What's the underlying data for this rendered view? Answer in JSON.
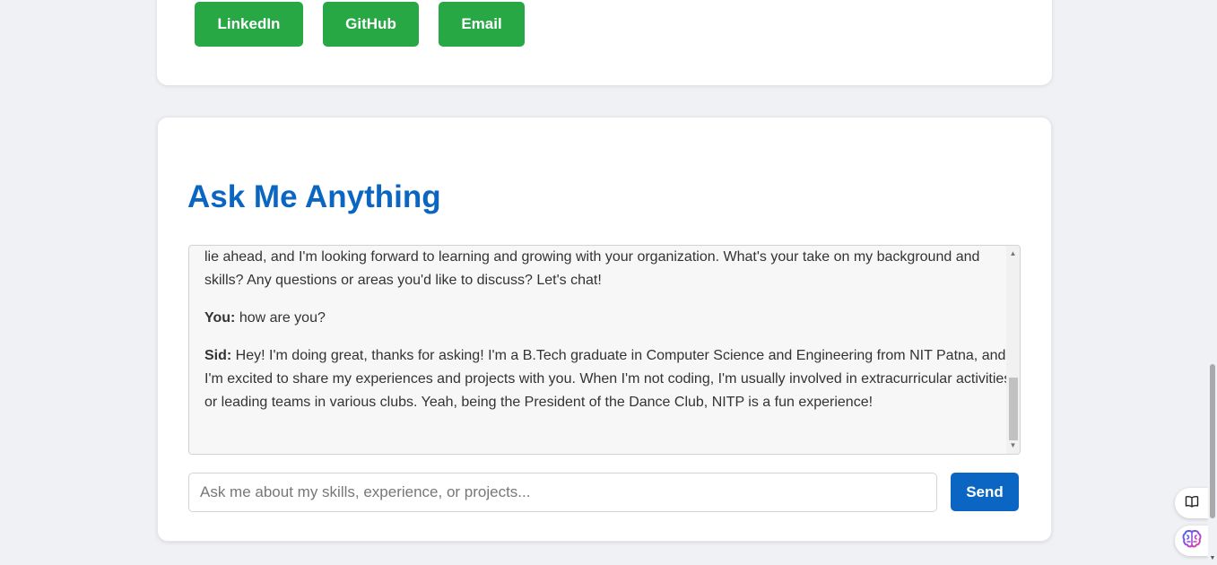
{
  "colors": {
    "social_button": "#28a745",
    "title": "#0a66c2",
    "send_button": "#0a66c2"
  },
  "social": {
    "linkedin_label": "LinkedIn",
    "github_label": "GitHub",
    "email_label": "Email"
  },
  "chat": {
    "title": "Ask Me Anything",
    "messages": [
      {
        "sender": "",
        "text": "management skills that have helped me excel in both my personal and professional life. I'm excited to see what opportunities lie ahead, and I'm looking forward to learning and growing with your organization. What's your take on my background and skills? Any questions or areas you'd like to discuss? Let's chat!"
      },
      {
        "sender": "You:",
        "text": "how are you?"
      },
      {
        "sender": "Sid:",
        "text": "Hey! I'm doing great, thanks for asking! I'm a B.Tech graduate in Computer Science and Engineering from NIT Patna, and I'm excited to share my experiences and projects with you. When I'm not coding, I'm usually involved in extracurricular activities or leading teams in various clubs. Yeah, being the President of the Dance Club, NITP is a fun experience!"
      }
    ],
    "input_placeholder": "Ask me about my skills, experience, or projects...",
    "input_value": "",
    "send_label": "Send"
  },
  "floating_buttons": [
    {
      "icon": "book-icon"
    },
    {
      "icon": "brain-icon"
    }
  ]
}
